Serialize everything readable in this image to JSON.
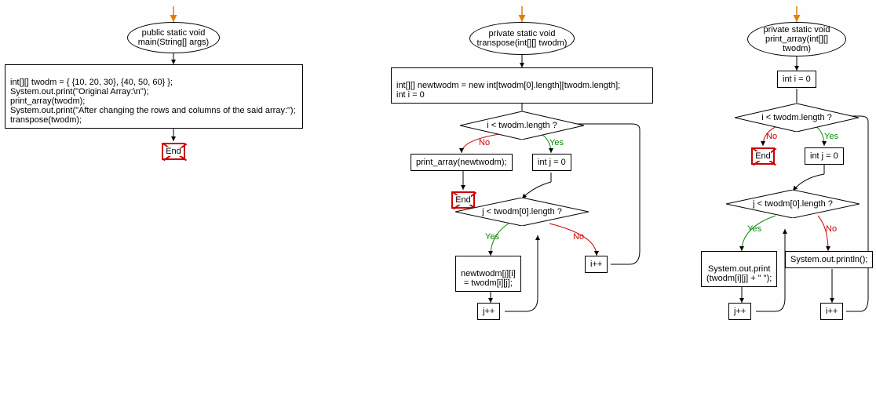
{
  "fc1": {
    "start": "public static void main(String[] args)",
    "code": "int[][] twodm = { {10, 20, 30}, {40, 50, 60} };\nSystem.out.print(\"Original Array:\\n\");\nprint_array(twodm);\nSystem.out.print(\"After changing the rows and columns of the said array:\");\ntranspose(twodm);",
    "end": "End"
  },
  "fc2": {
    "start": "private static void transpose(int[][] twodm)",
    "init": "int[][] newtwodm = new int[twodm[0].length][twodm.length];\nint i = 0",
    "cond1": "i < twodm.length ?",
    "no_branch": "print_array(newtwodm);",
    "yes_branch": "int j = 0",
    "cond2": "j < twodm[0].length ?",
    "inner_yes": "newtwodm[j][i]\n= twodm[i][j];",
    "jpp": "j++",
    "ipp": "i++",
    "end": "End",
    "yes": "Yes",
    "no": "No"
  },
  "fc3": {
    "start": "private static void print_array(int[][] twodm)",
    "init": "int i = 0",
    "cond1": "i < twodm.length ?",
    "yes_branch": "int j = 0",
    "cond2": "j < twodm[0].length ?",
    "inner_yes": "System.out.print\n(twodm[i][j] + \" \");",
    "inner_no": "System.out.println();",
    "jpp": "j++",
    "ipp": "i++",
    "end": "End",
    "yes": "Yes",
    "no": "No"
  }
}
